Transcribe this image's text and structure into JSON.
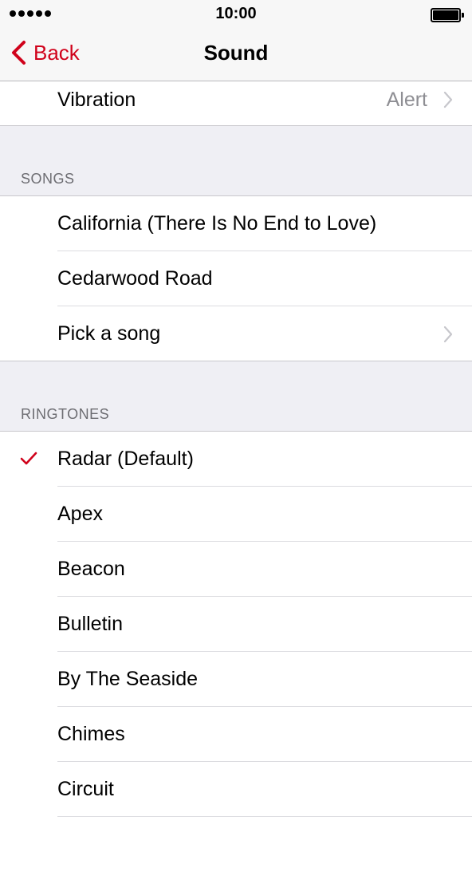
{
  "status_bar": {
    "time": "10:00"
  },
  "nav": {
    "back_label": "Back",
    "title": "Sound"
  },
  "vibration": {
    "label": "Vibration",
    "value": "Alert"
  },
  "songs": {
    "header": "SONGS",
    "items": [
      {
        "label": "California (There Is No End to Love)"
      },
      {
        "label": "Cedarwood Road"
      },
      {
        "label": "Pick a song"
      }
    ]
  },
  "ringtones": {
    "header": "RINGTONES",
    "selected": "Radar (Default)",
    "items": [
      {
        "label": "Radar (Default)"
      },
      {
        "label": "Apex"
      },
      {
        "label": "Beacon"
      },
      {
        "label": "Bulletin"
      },
      {
        "label": "By The Seaside"
      },
      {
        "label": "Chimes"
      },
      {
        "label": "Circuit"
      }
    ]
  },
  "colors": {
    "accent": "#d0021b",
    "background": "#efeff4",
    "secondary_text": "#8e8e93"
  }
}
